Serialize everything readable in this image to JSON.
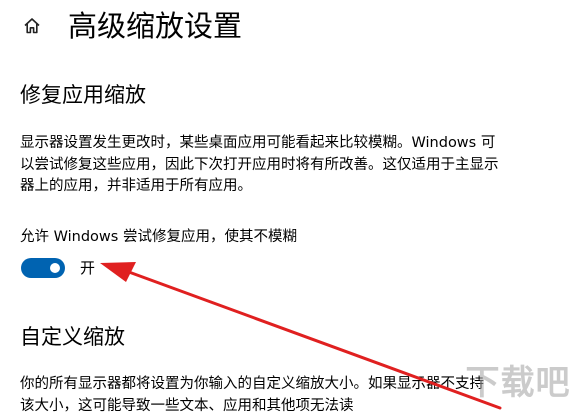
{
  "header": {
    "home_icon": "home-icon",
    "title": "高级缩放设置"
  },
  "fix_scaling": {
    "title": "修复应用缩放",
    "description": "显示器设置发生更改时，某些桌面应用可能看起来比较模糊。Windows 可以尝试修复这些应用，因此下次打开应用时将有所改善。这仅适用于主显示器上的应用，并非适用于所有应用。",
    "setting_label": "允许 Windows 尝试修复应用，使其不模糊",
    "toggle_on": true,
    "toggle_state": "开",
    "toggle_color": "#0063b1"
  },
  "custom_scaling": {
    "title": "自定义缩放",
    "description": "你的所有显示器都将设置为你输入的自定义缩放大小。如果显示器不支持该大小，这可能导致一些文本、应用和其他项无法读"
  },
  "annotation": {
    "arrow_color": "#e02020"
  },
  "watermark": {
    "text": "下载吧"
  }
}
